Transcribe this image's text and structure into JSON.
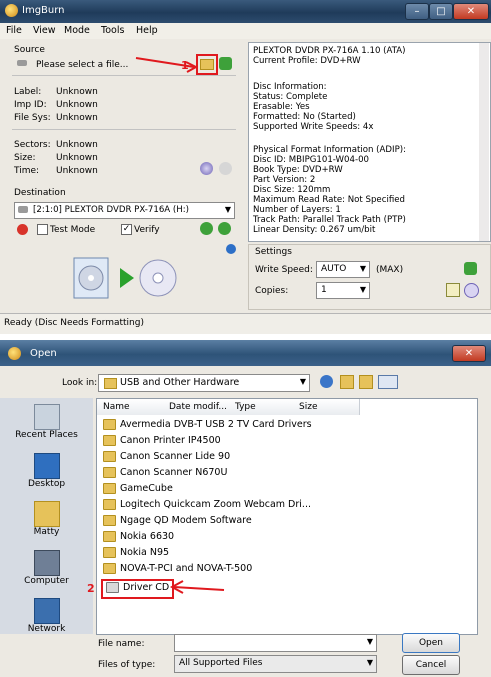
{
  "imgburn": {
    "title": "ImgBurn",
    "menu": [
      "File",
      "View",
      "Mode",
      "Tools",
      "Help"
    ],
    "source": {
      "heading": "Source",
      "file_prompt": "Please select a file...",
      "annot_num": "1",
      "fields": [
        {
          "label": "Label:",
          "value": "Unknown"
        },
        {
          "label": "Imp ID:",
          "value": "Unknown"
        },
        {
          "label": "File Sys:",
          "value": "Unknown"
        }
      ],
      "fields2": [
        {
          "label": "Sectors:",
          "value": "Unknown"
        },
        {
          "label": "Size:",
          "value": "Unknown"
        },
        {
          "label": "Time:",
          "value": "Unknown"
        }
      ]
    },
    "destination": {
      "heading": "Destination",
      "drive": "[2:1:0] PLEXTOR DVDR   PX-716A (H:)",
      "test_mode_label": "Test Mode",
      "verify_label": "Verify",
      "verify_checked": true
    },
    "info_lines": [
      "PLEXTOR DVDR   PX-716A 1.10 (ATA)",
      "Current Profile: DVD+RW",
      "",
      "Disc Information:",
      "Status: Complete",
      "Erasable: Yes",
      "Formatted: No (Started)",
      "Supported Write Speeds: 4x",
      "",
      "Physical Format Information (ADIP):",
      "Disc ID: MBIPG101-W04-00",
      "Book Type: DVD+RW",
      "Part Version: 2",
      "Disc Size: 120mm",
      "Maximum Read Rate: Not Specified",
      "Number of Layers: 1",
      "Track Path: Parallel Track Path (PTP)",
      "Linear Density: 0.267 um/bit"
    ],
    "settings": {
      "heading": "Settings",
      "write_speed_label": "Write Speed:",
      "write_speed_value": "AUTO",
      "write_speed_note": "(MAX)",
      "copies_label": "Copies:",
      "copies_value": "1"
    },
    "status": "Ready (Disc Needs Formatting)"
  },
  "open_dialog": {
    "title": "Open",
    "look_in_label": "Look in:",
    "look_in_value": "USB and Other Hardware",
    "places": [
      "Recent Places",
      "Desktop",
      "Matty",
      "Computer",
      "Network"
    ],
    "columns": [
      "Name",
      "Date modif...",
      "Type",
      "Size"
    ],
    "items": [
      "Avermedia DVB-T USB 2 TV Card Drivers",
      "Canon Printer IP4500",
      "Canon Scanner Lide 90",
      "Canon Scanner N670U",
      "GameCube",
      "Logitech Quickcam Zoom Webcam Dri...",
      "Ngage QD Modem Software",
      "Nokia 6630",
      "Nokia N95",
      "NOVA-T-PCI and NOVA-T-500",
      "Driver CD"
    ],
    "annot_num": "2",
    "file_name_label": "File name:",
    "file_name_value": "",
    "files_of_type_label": "Files of type:",
    "files_of_type_value": "All Supported Files",
    "open_label": "Open",
    "cancel_label": "Cancel"
  },
  "colors": {
    "annotation": "#e0191e",
    "accent": "#2e5378"
  }
}
